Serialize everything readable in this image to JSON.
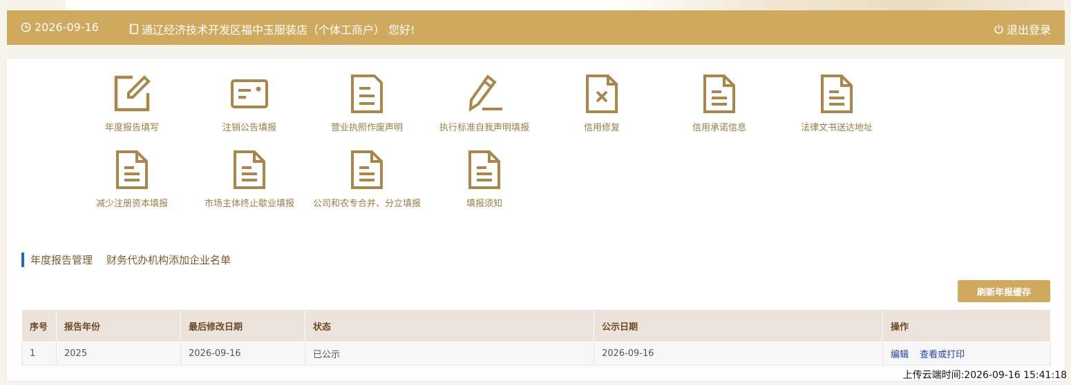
{
  "header": {
    "date": "2026-09-16",
    "greeting": "通辽经济技术开发区福中玉服装店（个体工商户） 您好!",
    "logout_label": "退出登录"
  },
  "tiles": [
    {
      "label": "年度报告填写",
      "icon": "edit-icon"
    },
    {
      "label": "注销公告填报",
      "icon": "id-card-icon"
    },
    {
      "label": "营业执照作废声明",
      "icon": "document-icon"
    },
    {
      "label": "执行标准自我声明填报",
      "icon": "pencil-icon"
    },
    {
      "label": "信用修复",
      "icon": "file-x-icon"
    },
    {
      "label": "信用承诺信息",
      "icon": "document-icon"
    },
    {
      "label": "法律文书送达地址",
      "icon": "document-icon"
    },
    {
      "label": "减少注册资本填报",
      "icon": "document-icon"
    },
    {
      "label": "市场主体终止歇业填报",
      "icon": "document-icon"
    },
    {
      "label": "公司和农专合并、分立填报",
      "icon": "document-icon"
    },
    {
      "label": "填报须知",
      "icon": "document-icon"
    }
  ],
  "tabs": [
    "年度报告管理",
    "财务代办机构添加企业名单"
  ],
  "refresh_button": "刷新年报缓存",
  "table": {
    "headers": [
      "序号",
      "报告年份",
      "最后修改日期",
      "状态",
      "公示日期",
      "操作"
    ],
    "rows": [
      {
        "index": "1",
        "year": "2025",
        "modified": "2026-09-16",
        "status": "已公示",
        "published": "2026-09-16",
        "actions": [
          "编辑",
          "查看或打印"
        ]
      }
    ]
  },
  "upload_time": "上传云端时间:2026-09-16 15:41:18",
  "colors": {
    "accent": "#cfaa5e",
    "icon": "#a9874a",
    "tab_bar": "#1d67c8",
    "link": "#1f3fb8"
  }
}
